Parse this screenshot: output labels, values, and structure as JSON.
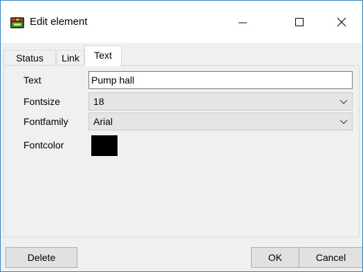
{
  "window": {
    "title": "Edit element",
    "icon": "app-icon"
  },
  "tabs": [
    {
      "label": "Status",
      "active": false
    },
    {
      "label": "Link",
      "active": false
    },
    {
      "label": "Text",
      "active": true
    }
  ],
  "form": {
    "text_label": "Text",
    "text_value": "Pump hall",
    "fontsize_label": "Fontsize",
    "fontsize_value": "18",
    "fontfamily_label": "Fontfamily",
    "fontfamily_value": "Arial",
    "fontcolor_label": "Fontcolor",
    "fontcolor_value": "#000000"
  },
  "buttons": {
    "delete_label": "Delete",
    "ok_label": "OK",
    "cancel_label": "Cancel"
  }
}
